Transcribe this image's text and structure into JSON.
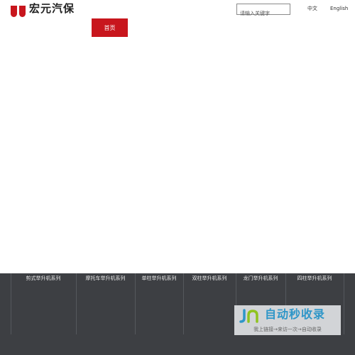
{
  "header": {
    "logo_text": "宏元汽保",
    "search": {
      "placeholder": "请输入关键字",
      "value": ""
    },
    "lang_zh": "中文",
    "lang_en": "English"
  },
  "nav": {
    "home": "首页"
  },
  "footer": {
    "categories": [
      "剪式举升机系列",
      "摩托车举升机系列",
      "单柱举升机系列",
      "双柱举升机系列",
      "龙门举升机系列",
      "四柱举升机系列"
    ]
  },
  "watermark": {
    "title": "自动秒收录",
    "subtitle": "我上链接→来访一次→自动收录",
    "accent": "#2e96c8"
  },
  "colors": {
    "brand_red": "#c8161d",
    "footer_bg": "#3d3f43"
  }
}
